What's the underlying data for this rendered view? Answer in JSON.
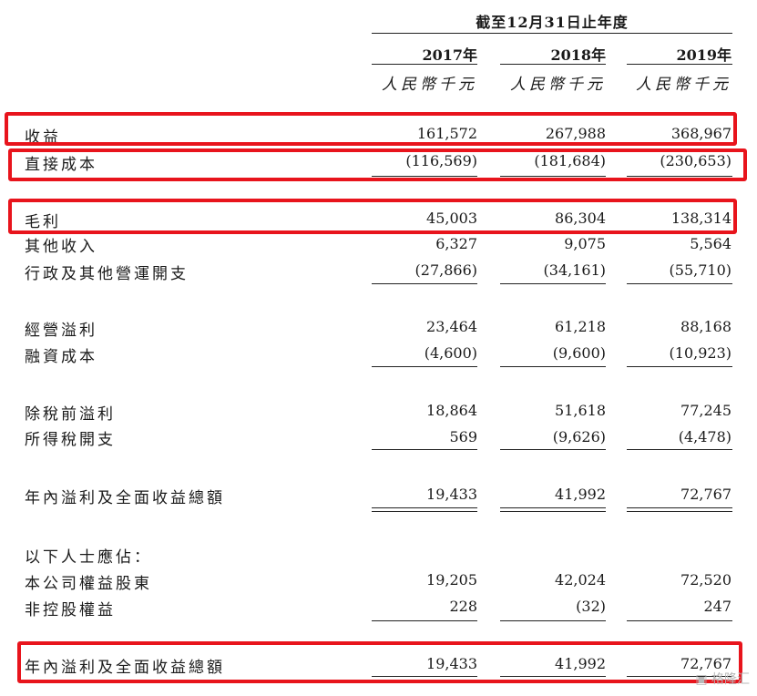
{
  "period_header": "截至12月31日止年度",
  "columns": [
    {
      "year": "2017年",
      "unit": "人民幣千元"
    },
    {
      "year": "2018年",
      "unit": "人民幣千元"
    },
    {
      "year": "2019年",
      "unit": "人民幣千元"
    }
  ],
  "rows": [
    {
      "label": "收益",
      "values": [
        "161,572",
        "267,988",
        "368,967"
      ]
    },
    {
      "label": "直接成本",
      "values": [
        "(116,569)",
        "(181,684)",
        "(230,653)"
      ]
    },
    {
      "label": "毛利",
      "values": [
        "45,003",
        "86,304",
        "138,314"
      ]
    },
    {
      "label": "其他收入",
      "values": [
        "6,327",
        "9,075",
        "5,564"
      ]
    },
    {
      "label": "行政及其他營運開支",
      "values": [
        "(27,866)",
        "(34,161)",
        "(55,710)"
      ]
    },
    {
      "label": "經營溢利",
      "values": [
        "23,464",
        "61,218",
        "88,168"
      ]
    },
    {
      "label": "融資成本",
      "values": [
        "(4,600)",
        "(9,600)",
        "(10,923)"
      ]
    },
    {
      "label": "除稅前溢利",
      "values": [
        "18,864",
        "51,618",
        "77,245"
      ]
    },
    {
      "label": "所得稅開支",
      "values": [
        "569",
        "(9,626)",
        "(4,478)"
      ]
    },
    {
      "label": "年內溢利及全面收益總額",
      "values": [
        "19,433",
        "41,992",
        "72,767"
      ]
    },
    {
      "label": "以下人士應佔：",
      "values": [
        "",
        "",
        ""
      ]
    },
    {
      "label": "本公司權益股東",
      "values": [
        "19,205",
        "42,024",
        "72,520"
      ]
    },
    {
      "label": "非控股權益",
      "values": [
        "228",
        "(32)",
        "247"
      ]
    },
    {
      "label": "年內溢利及全面收益總額",
      "values": [
        "19,433",
        "41,992",
        "72,767"
      ]
    }
  ],
  "watermark": "格隆汇",
  "highlight_color": "#e8141c"
}
